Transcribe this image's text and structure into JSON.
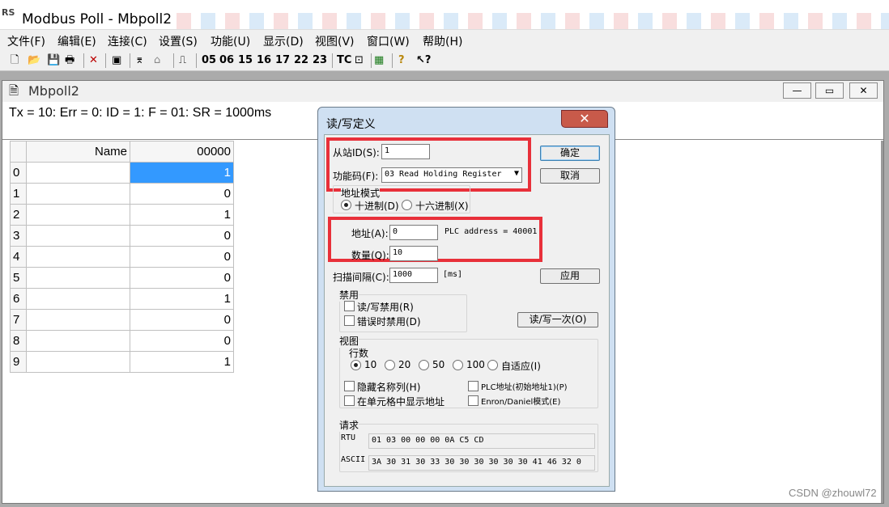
{
  "app": {
    "icon_text": "RS",
    "title": "Modbus Poll - Mbpoll2"
  },
  "menu": [
    "文件(F)",
    "编辑(E)",
    "连接(C)",
    "设置(S)",
    "功能(U)",
    "显示(D)",
    "视图(V)",
    "窗口(W)",
    "帮助(H)"
  ],
  "toolbar": {
    "function_codes": [
      "05",
      "06",
      "15",
      "16",
      "17",
      "22",
      "23"
    ],
    "tc_label": "TC"
  },
  "child_window": {
    "title": "Mbpoll2",
    "status": "Tx = 10: Err = 0: ID = 1: F = 01: SR = 1000ms",
    "minimize": "—",
    "maximize": "▭",
    "close": "✕"
  },
  "grid": {
    "headers": {
      "name": "Name",
      "address": "00000"
    },
    "rows": [
      {
        "idx": "0",
        "name": "",
        "value": "1"
      },
      {
        "idx": "1",
        "name": "",
        "value": "0"
      },
      {
        "idx": "2",
        "name": "",
        "value": "1"
      },
      {
        "idx": "3",
        "name": "",
        "value": "0"
      },
      {
        "idx": "4",
        "name": "",
        "value": "0"
      },
      {
        "idx": "5",
        "name": "",
        "value": "0"
      },
      {
        "idx": "6",
        "name": "",
        "value": "1"
      },
      {
        "idx": "7",
        "name": "",
        "value": "0"
      },
      {
        "idx": "8",
        "name": "",
        "value": "0"
      },
      {
        "idx": "9",
        "name": "",
        "value": "1"
      }
    ]
  },
  "dialog": {
    "title": "读/写定义",
    "close": "✕",
    "slave_id_label": "从站ID(S):",
    "slave_id_value": "1",
    "function_label": "功能码(F):",
    "function_value": "03 Read Holding Register",
    "ok": "确定",
    "cancel": "取消",
    "address_mode_label": "地址模式",
    "decimal_label": "十进制(D)",
    "hex_label": "十六进制(X)",
    "address_label": "地址(A):",
    "address_value": "0",
    "plc_address_text": "PLC address = 40001",
    "quantity_label": "数量(Q):",
    "quantity_value": "10",
    "scan_rate_label": "扫描间隔(C):",
    "scan_rate_value": "1000",
    "scan_rate_unit": "[ms]",
    "apply": "应用",
    "disable_group": "禁用",
    "disable_rw": "读/写禁用(R)",
    "disable_on_error": "错误时禁用(D)",
    "read_write_once": "读/写一次(O)",
    "view_group": "视图",
    "rows_label": "行数",
    "rows_options": [
      "10",
      "20",
      "50",
      "100",
      "自适应(I)"
    ],
    "hide_name_column": "隐藏名称列(H)",
    "plc_addresses": "PLC地址(初始地址1)(P)",
    "show_address_in_cell": "在单元格中显示地址",
    "enron_daniel": "Enron/Daniel模式(E)",
    "request_group": "请求",
    "rtu_label": "RTU",
    "rtu_value": "01 03 00 00 00 0A C5 CD",
    "ascii_label": "ASCII",
    "ascii_value": "3A 30 31 30 33 30 30 30 30 30 30 41 46 32 0"
  },
  "watermark": "CSDN @zhouwl72",
  "colors": {
    "highlight_red": "#e8303a",
    "selection_blue": "#3399ff",
    "close_red": "#c85a4a"
  }
}
